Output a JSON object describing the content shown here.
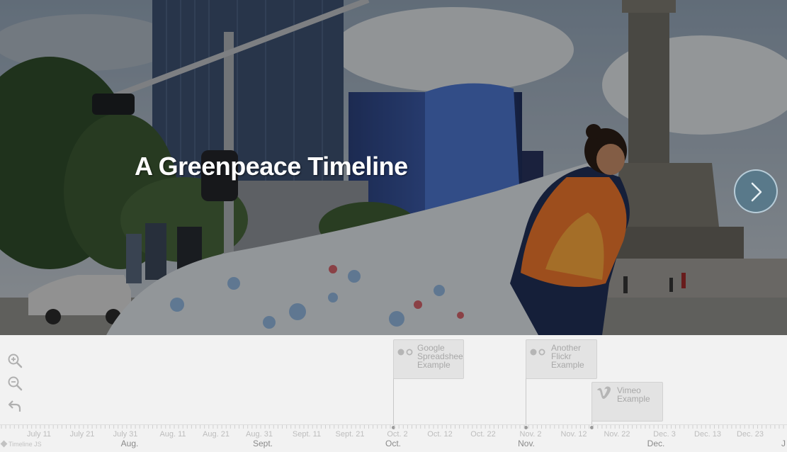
{
  "slide": {
    "title": "A Greenpeace Timeline"
  },
  "colors": {
    "accent": "#4b7a8f",
    "nav_background": "#f2f2f2",
    "marker_background": "#e3e3e3",
    "marker_text": "#a8a8a8"
  },
  "controls": {
    "zoom_in_icon": "zoom-in-icon",
    "zoom_out_icon": "zoom-out-icon",
    "back_icon": "undo-arrow-icon",
    "next_icon": "chevron-right-icon"
  },
  "markers": [
    {
      "label": "Google\nSpreadsheet\nExample",
      "icon": "spreadsheet-icon"
    },
    {
      "label": "Another\nFlickr\nExample",
      "icon": "flickr-icon"
    },
    {
      "label": "Vimeo\nExample",
      "icon": "vimeo-icon"
    }
  ],
  "axis": {
    "minor_labels": [
      "July 11",
      "July 21",
      "July 31",
      "Aug. 11",
      "Aug. 21",
      "Aug. 31",
      "Sept. 11",
      "Sept. 21",
      "Oct. 2",
      "Oct. 12",
      "Oct. 22",
      "Nov. 2",
      "Nov. 12",
      "Nov. 22",
      "Dec. 3",
      "Dec. 13",
      "Dec. 23"
    ],
    "major_labels": [
      "Aug.",
      "Sept.",
      "Oct.",
      "Nov.",
      "Dec.",
      "J"
    ]
  },
  "attribution": "Timeline JS"
}
